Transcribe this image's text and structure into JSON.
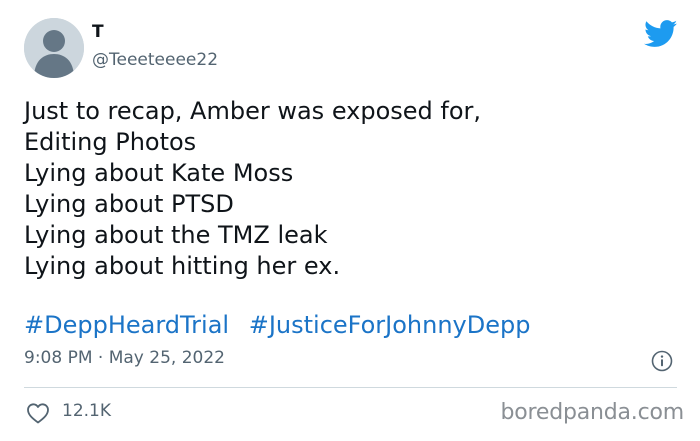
{
  "author": {
    "display_name": "T",
    "handle": "@Teeeteeee22"
  },
  "tweet": {
    "lines": [
      "Just to recap, Amber was exposed for,",
      "Editing Photos",
      "Lying about Kate Moss",
      "Lying about PTSD",
      "Lying about the TMZ leak",
      "Lying about hitting her ex."
    ],
    "hashtags": [
      "#DeppHeardTrial",
      "#JusticeForJohnnyDepp"
    ],
    "timestamp": "9:08 PM · May 25, 2022"
  },
  "engagement": {
    "likes": "12.1K"
  },
  "watermark": "boredpanda.com",
  "icons": {
    "bird": "twitter-bird-icon",
    "info": "info-icon",
    "like": "heart-icon",
    "avatar": "default-avatar"
  },
  "colors": {
    "twitter_blue": "#1d9bf0",
    "hashtag": "#1b74c7",
    "secondary_text": "#536471",
    "avatar_bg": "#ccd6dd"
  }
}
